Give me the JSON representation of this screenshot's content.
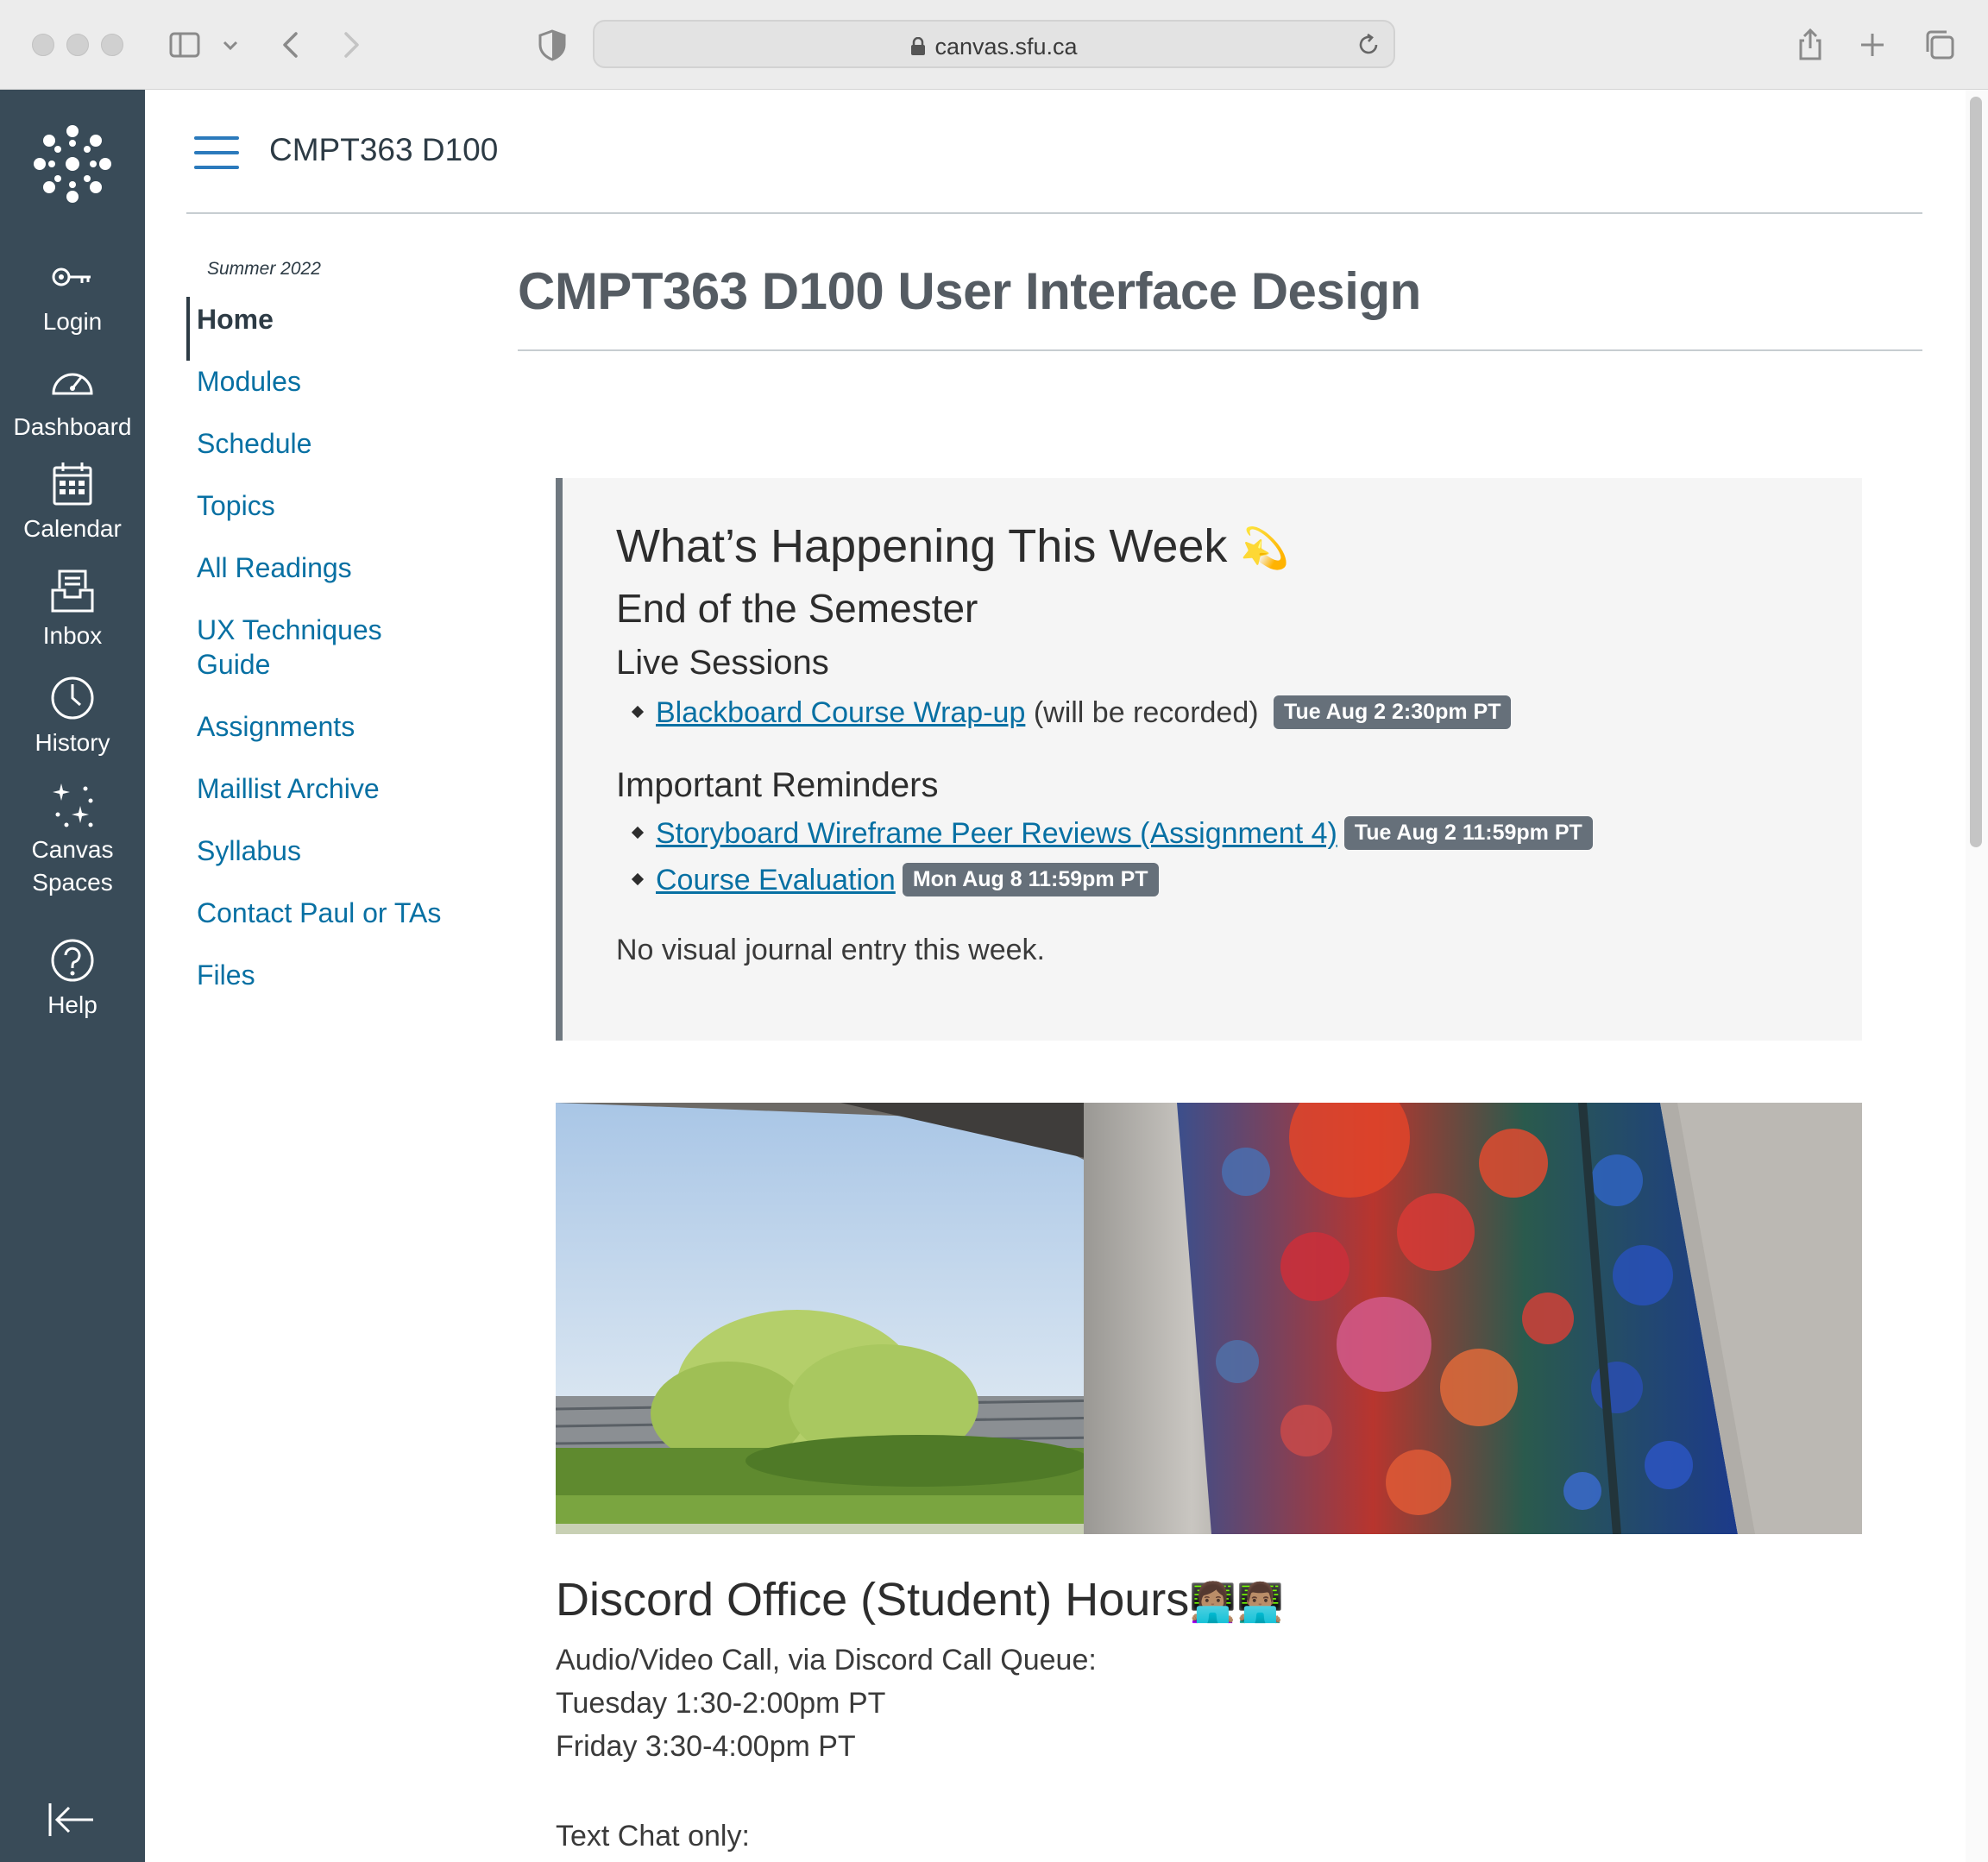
{
  "browser": {
    "url": "canvas.sfu.ca"
  },
  "global_nav": {
    "items": [
      {
        "label": "Login",
        "icon": "key-icon"
      },
      {
        "label": "Dashboard",
        "icon": "dashboard-gauge-icon"
      },
      {
        "label": "Calendar",
        "icon": "calendar-icon"
      },
      {
        "label": "Inbox",
        "icon": "inbox-icon"
      },
      {
        "label": "History",
        "icon": "clock-icon"
      },
      {
        "label": "Canvas",
        "label2": "Spaces",
        "icon": "sparkles-icon"
      },
      {
        "label": "Help",
        "icon": "help-icon"
      }
    ],
    "bg_color": "#394b58"
  },
  "course": {
    "code": "CMPT363 D100",
    "term": "Summer 2022",
    "nav": [
      {
        "label": "Home",
        "active": true
      },
      {
        "label": "Modules"
      },
      {
        "label": "Schedule"
      },
      {
        "label": "Topics"
      },
      {
        "label": "All Readings"
      },
      {
        "label": "UX Techniques",
        "label2": "Guide"
      },
      {
        "label": "Assignments"
      },
      {
        "label": "Maillist Archive"
      },
      {
        "label": "Syllabus"
      },
      {
        "label": "Contact Paul or TAs"
      },
      {
        "label": "Files"
      }
    ],
    "link_color": "#0770a3"
  },
  "main": {
    "title": "CMPT363 D100 User Interface Design",
    "week": {
      "heading": "What’s Happening This Week",
      "heading_emoji": "💫",
      "subheading": "End of the Semester",
      "live_heading": "Live Sessions",
      "live_items": [
        {
          "link": "Blackboard Course Wrap-up",
          "suffix": "(will be recorded)",
          "badge": "Tue Aug 2 2:30pm PT"
        }
      ],
      "reminders_heading": "Important Reminders",
      "reminders": [
        {
          "link": "Storyboard Wireframe Peer Reviews (Assignment 4)",
          "badge": "Tue Aug 2 11:59pm PT"
        },
        {
          "link": "Course Evaluation",
          "badge": "Mon Aug 8 11:59pm PT"
        }
      ],
      "note": "No visual journal entry this week."
    },
    "discord": {
      "title": "Discord Office (Student) Hours",
      "title_emoji": "👩🏽‍💻👨🏽‍💻",
      "lines": [
        "Audio/Video Call, via Discord Call Queue:",
        "Tuesday 1:30-2:00pm PT",
        "Friday 3:30-4:00pm PT",
        "Text Chat only:"
      ]
    }
  }
}
